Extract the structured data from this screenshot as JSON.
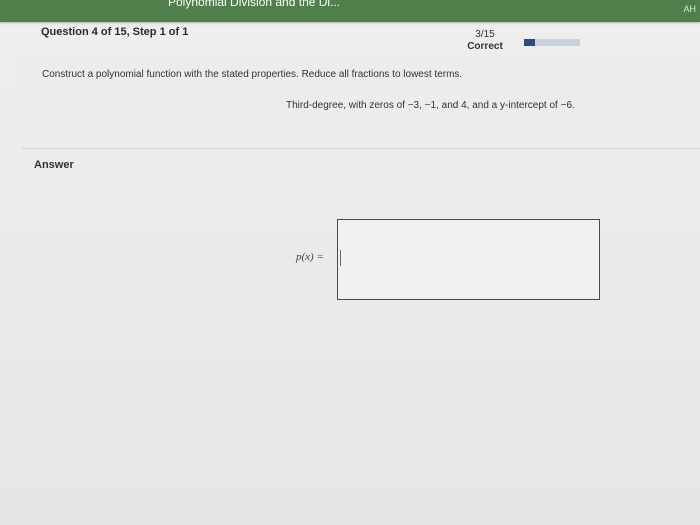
{
  "topbar": {
    "title": "Polynomial Division and the Di...",
    "initials": "AH",
    "color": "#4f7f4a"
  },
  "question": {
    "label": "Question 4 of 15, Step 1 of 1",
    "score": "3/15",
    "status": "Correct",
    "progress_fraction": 0.2
  },
  "prompt": {
    "instruction": "Construct a polynomial function with the stated properties. Reduce all fractions to lowest terms.",
    "properties": "Third-degree, with zeros of −3, −1, and 4, and a y-intercept of −6."
  },
  "answer": {
    "label": "Answer",
    "function_label": "p(x) =",
    "value": ""
  }
}
